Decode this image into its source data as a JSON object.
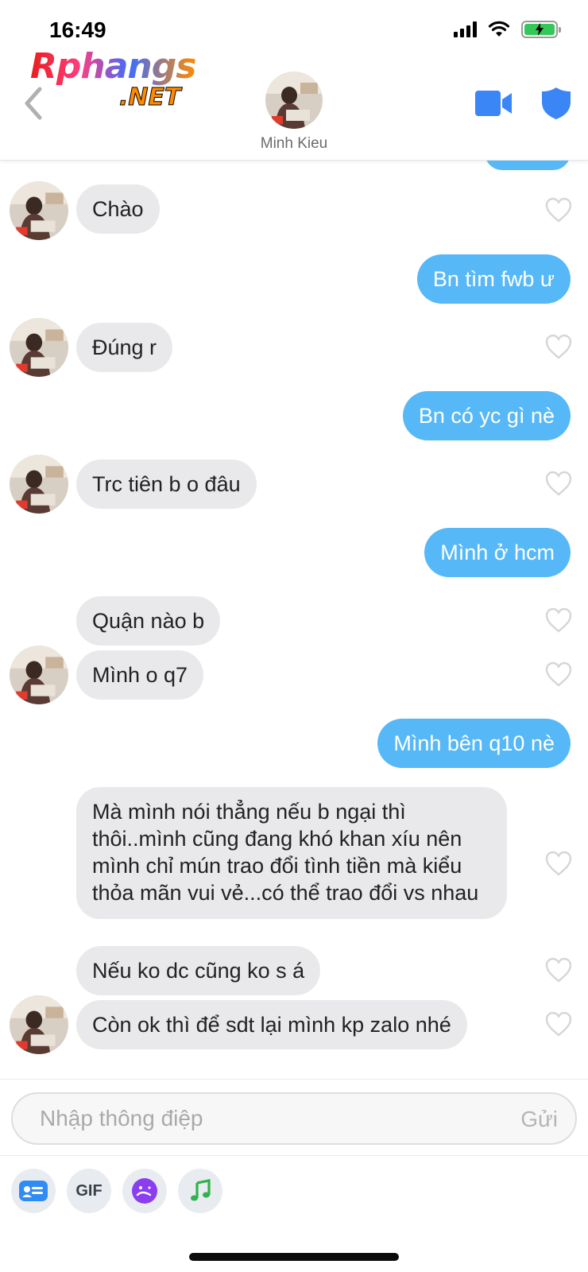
{
  "status_bar": {
    "time": "16:49"
  },
  "watermark": {
    "line1": "Rphangs",
    "line2": ".NET"
  },
  "header": {
    "contact_name": "Minh Kieu"
  },
  "messages": [
    {
      "side": "recv",
      "text": "Chào"
    },
    {
      "side": "sent",
      "text": "Bn tìm fwb ư"
    },
    {
      "side": "recv",
      "text": "Đúng r"
    },
    {
      "side": "sent",
      "text": "Bn có yc gì nè"
    },
    {
      "side": "recv",
      "text": "Trc tiên b o đâu"
    },
    {
      "side": "sent",
      "text": "Mình ở hcm"
    },
    {
      "side": "recv",
      "text": "Quận nào b"
    },
    {
      "side": "recv",
      "text": "Mình o q7"
    },
    {
      "side": "sent",
      "text": "Mình bên q10 nè"
    },
    {
      "side": "recv",
      "text": "Mà mình nói thẳng nếu b ngại thì thôi..mình cũng đang khó khan xíu nên mình chỉ mún trao đổi tình tiền mà kiểu thỏa mãn vui vẻ...có thể trao đổi vs nhau"
    },
    {
      "side": "recv",
      "text": "Nếu ko dc cũng ko s á"
    },
    {
      "side": "recv",
      "text": "Còn ok thì để sdt lại mình kp zalo nhé"
    }
  ],
  "composer": {
    "placeholder": "Nhập thông điệp",
    "send_label": "Gửi"
  },
  "tools": {
    "gif_label": "GIF"
  },
  "colors": {
    "sent_bubble": "#57b8f7",
    "recv_bubble": "#e9e9eb",
    "accent_blue": "#3a86f6"
  },
  "icons": [
    "back-chevron-icon",
    "video-call-icon",
    "shield-icon",
    "heart-icon",
    "contact-card-icon",
    "gif-icon",
    "sticker-icon",
    "music-icon"
  ]
}
